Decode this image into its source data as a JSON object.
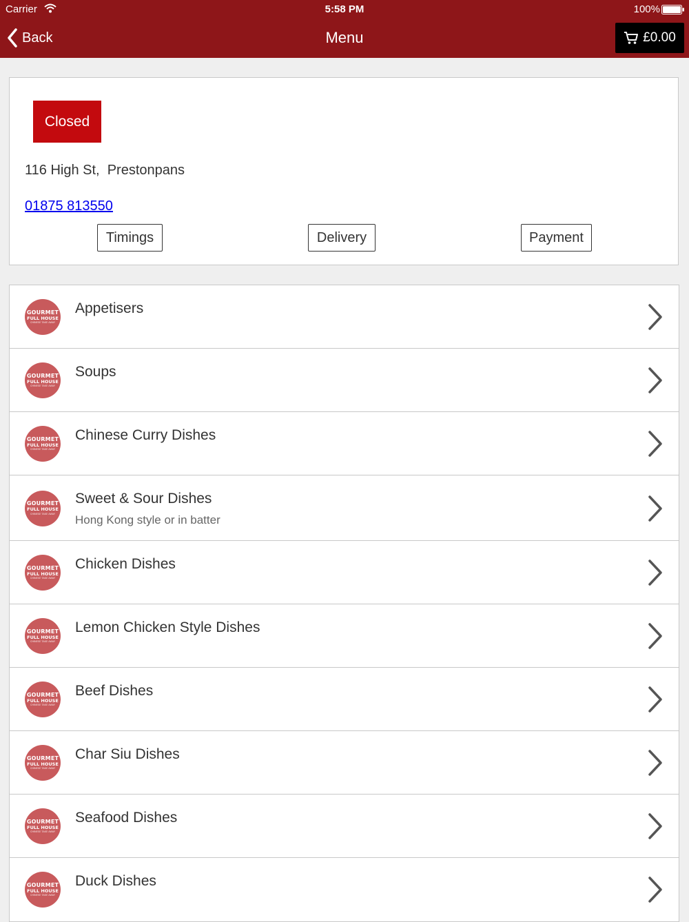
{
  "status_bar": {
    "carrier": "Carrier",
    "time": "5:58 PM",
    "battery": "100%"
  },
  "nav": {
    "back_label": "Back",
    "title": "Menu",
    "cart_total": "£0.00"
  },
  "info": {
    "status": "Closed",
    "address": "116 High St,  Prestonpans",
    "phone": "01875 813550",
    "buttons": [
      "Timings",
      "Delivery",
      "Payment"
    ]
  },
  "logo": {
    "line1": "GOURMET",
    "line2": "FULL HOUSE",
    "line3": "CHINESE TAKE AWAY"
  },
  "categories": [
    {
      "title": "Appetisers",
      "subtitle": ""
    },
    {
      "title": "Soups",
      "subtitle": ""
    },
    {
      "title": "Chinese Curry Dishes",
      "subtitle": ""
    },
    {
      "title": "Sweet & Sour Dishes",
      "subtitle": "Hong Kong style or in batter"
    },
    {
      "title": "Chicken Dishes",
      "subtitle": ""
    },
    {
      "title": "Lemon Chicken Style Dishes",
      "subtitle": ""
    },
    {
      "title": "Beef Dishes",
      "subtitle": ""
    },
    {
      "title": "Char Siu Dishes",
      "subtitle": ""
    },
    {
      "title": "Seafood Dishes",
      "subtitle": ""
    },
    {
      "title": "Duck Dishes",
      "subtitle": ""
    }
  ],
  "colors": {
    "header": "#8e1619",
    "closed_badge": "#c30a0e",
    "logo": "#c85a5c",
    "link": "#0000ee"
  }
}
